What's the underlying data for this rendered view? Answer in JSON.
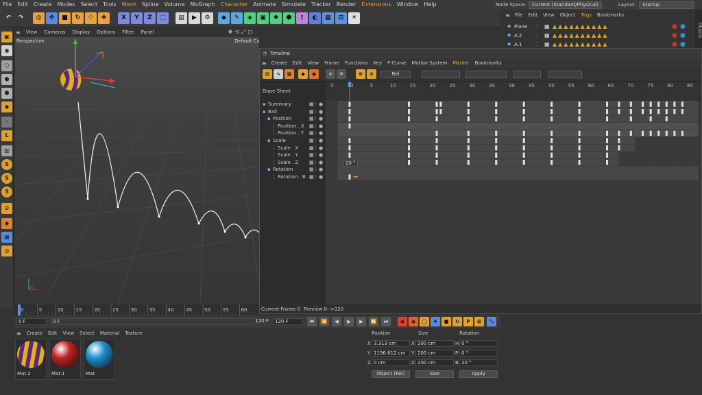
{
  "menubar": {
    "items": [
      "File",
      "Edit",
      "Create",
      "Modes",
      "Select",
      "Tools",
      "Mesh",
      "Spline",
      "Volume",
      "MoGraph",
      "Character",
      "Animate",
      "Simulate",
      "Tracker",
      "Render",
      "Extensions",
      "Window",
      "Help"
    ],
    "highlighted": [
      "Mesh",
      "Character",
      "Extensions"
    ],
    "node_space_label": "Node Space:",
    "node_space_value": "Current (Standard/Physical)",
    "layout_label": "Layout:",
    "layout_value": "Startup"
  },
  "object_manager": {
    "menu": [
      "File",
      "Edit",
      "View",
      "Object",
      "Tags",
      "Bookmarks"
    ],
    "objects": [
      {
        "name": "Plane"
      },
      {
        "name": "A.2"
      },
      {
        "name": "A.1"
      }
    ],
    "side_tab": "Objects"
  },
  "viewport": {
    "menu": [
      "View",
      "Cameras",
      "Display",
      "Options",
      "Filter",
      "Panel"
    ],
    "name": "Perspective",
    "camera": "Default Camera"
  },
  "timeline": {
    "title": "Timeline",
    "menu": [
      "Create",
      "Edit",
      "View",
      "Frame",
      "Functions",
      "Key",
      "F-Curve",
      "Motion System",
      "Marker",
      "Bookmarks"
    ],
    "highlighted": [
      "Marker"
    ],
    "mode": "Dope Sheet",
    "ruler": [
      "5",
      "0",
      "5",
      "10",
      "15",
      "20",
      "25",
      "30",
      "35",
      "40",
      "45",
      "50",
      "55",
      "60",
      "65",
      "70",
      "75",
      "80",
      "85"
    ],
    "tracks": [
      {
        "label": "Summary",
        "indent": 0
      },
      {
        "label": "Ball",
        "indent": 0
      },
      {
        "label": "Position",
        "indent": 1
      },
      {
        "label": "Position . X",
        "indent": 2
      },
      {
        "label": "Position . Y",
        "indent": 2
      },
      {
        "label": "Scale",
        "indent": 1
      },
      {
        "label": "Scale . X",
        "indent": 2
      },
      {
        "label": "Scale . Y",
        "indent": 2
      },
      {
        "label": "Scale . Z",
        "indent": 2
      },
      {
        "label": "Rotation",
        "indent": 1
      },
      {
        "label": "Rotation . B",
        "indent": 2
      }
    ],
    "tooltip": "20 °",
    "status_frame": "Current Frame  0",
    "status_preview": "Preview  0-->120"
  },
  "time_ruler": [
    "0",
    "5",
    "10",
    "15",
    "20",
    "25",
    "30",
    "35",
    "40",
    "45",
    "50",
    "55",
    "60"
  ],
  "time_controls": {
    "start": "0 F",
    "current": "0 F",
    "end": "120 F",
    "max": "120 F"
  },
  "material_manager": {
    "menu": [
      "Create",
      "Edit",
      "View",
      "Select",
      "Material",
      "Texture"
    ],
    "materials": [
      {
        "name": "Mat.2",
        "color": "striped"
      },
      {
        "name": "Mat.1",
        "color": "#c02020"
      },
      {
        "name": "Mat",
        "color": "#2090d0"
      }
    ]
  },
  "attributes": {
    "headers": [
      "Position",
      "Size",
      "Rotation"
    ],
    "rows": [
      {
        "axis": "X",
        "pos": "3.313 cm",
        "size_axis": "X",
        "size": "200 cm",
        "rot_axis": "H",
        "rot": "0 °"
      },
      {
        "axis": "Y",
        "pos": "1196.612 cm",
        "size_axis": "Y",
        "size": "200 cm",
        "rot_axis": "P",
        "rot": "0 °"
      },
      {
        "axis": "Z",
        "pos": "0 cm",
        "size_axis": "Z",
        "size": "200 cm",
        "rot_axis": "B",
        "rot": "20 °"
      }
    ],
    "mode_select": "Object (Rel)",
    "size_select": "Size",
    "apply": "Apply"
  },
  "colors": {
    "accent": "#f0a030",
    "keyframe": "#d8d8d8",
    "track_bg": "#4a4a4a"
  }
}
